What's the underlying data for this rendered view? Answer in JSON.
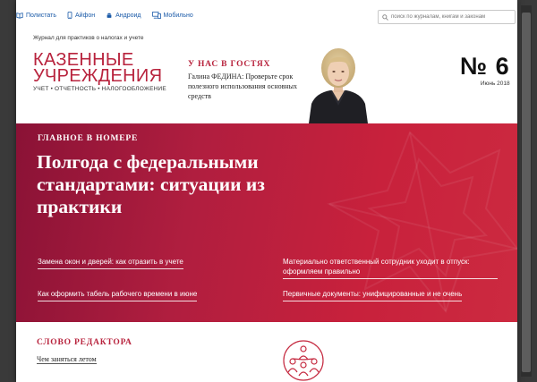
{
  "topbar": {
    "platforms": [
      {
        "label": "Полистать",
        "icon": "book-icon"
      },
      {
        "label": "Айфон",
        "icon": "phone-icon"
      },
      {
        "label": "Андроид",
        "icon": "android-icon"
      },
      {
        "label": "Мобильно",
        "icon": "device-icon"
      }
    ],
    "search_placeholder": "поиск по журналам, книгам и законам"
  },
  "header": {
    "tagline": "Журнал для практиков о налогах и учете",
    "logo_line1": "КАЗЕННЫЕ",
    "logo_line2": "УЧРЕЖДЕНИЯ",
    "logo_subtitle": "УЧЕТ • ОТЧЕТНОСТЬ • НАЛОГООБЛОЖЕНИЕ",
    "guest_label": "У НАС В ГОСТЯХ",
    "guest_text": "Галина ФЕДИНА: Проверьте срок полезного использования основных средств",
    "issue_number": "№ 6",
    "issue_date": "Июнь 2018"
  },
  "hero": {
    "label": "ГЛАВНОЕ В НОМЕРЕ",
    "title": "Полгода с федеральными стандартами: ситуации из практики",
    "links": [
      "Замена окон и дверей: как отразить в учете",
      "Материально ответственный сотрудник уходит в отпуск: оформляем правильно",
      "Как оформить табель рабочего времени в июне",
      "Первичные документы: унифицированные и не очень"
    ]
  },
  "editor": {
    "label": "СЛОВО РЕДАКТОРА",
    "link": "Чем заняться летом"
  },
  "colors": {
    "brand": "#b8233d",
    "hero_start": "#8a1236",
    "hero_end": "#cc2a40",
    "link_blue": "#1a5aa8"
  }
}
